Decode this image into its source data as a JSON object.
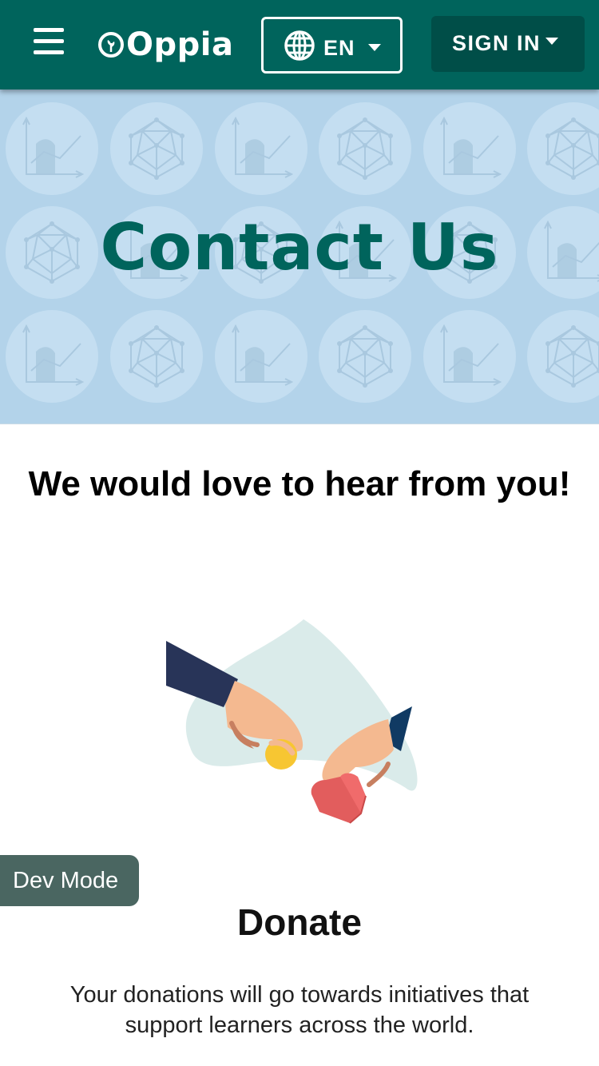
{
  "nav": {
    "menu_icon": "hamburger-menu-icon",
    "logo_text": "Oppia",
    "logo_icon": "oppia-logo-icon",
    "language": {
      "icon": "globe-icon",
      "label": "EN"
    },
    "sign_in_label": "SIGN IN",
    "colors": {
      "bar": "#00645c",
      "sign_in_bg": "#004e48"
    }
  },
  "banner": {
    "title": "Contact Us",
    "background": "#b3d3ea",
    "title_color": "#00645c"
  },
  "headline": "We would love to hear from you!",
  "dev_mode_label": "Dev Mode",
  "donate": {
    "title": "Donate",
    "body": "Your donations will go towards initiatives that support learners across the world.",
    "illustration": "donation-hands-illustration"
  }
}
